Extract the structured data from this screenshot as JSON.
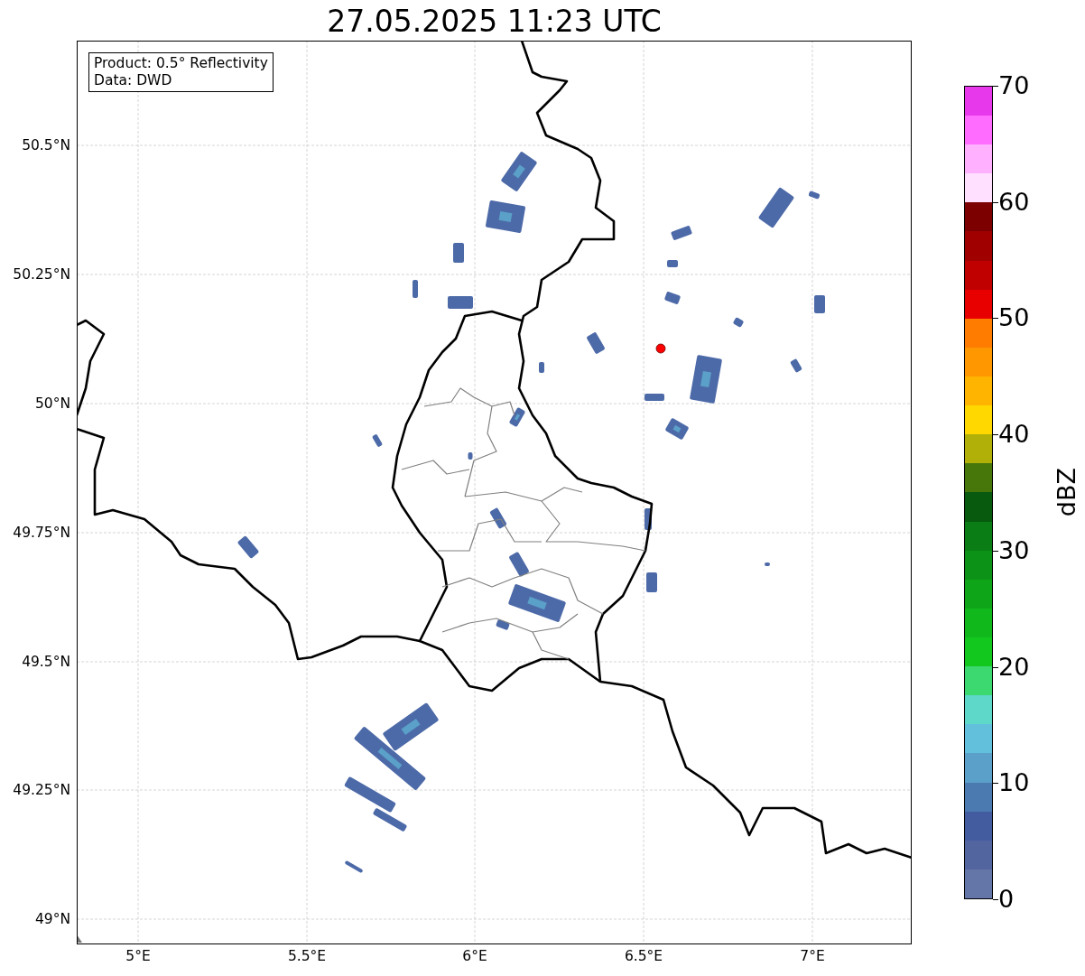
{
  "title": "27.05.2025 11:23 UTC",
  "map": {
    "info_lines": [
      "Product: 0.5° Reflectivity",
      "Data: DWD"
    ],
    "xtick_labels": [
      "5°E",
      "5.5°E",
      "6°E",
      "6.5°E",
      "7°E"
    ],
    "ytick_labels": [
      "50.5°N",
      "50.25°N",
      "50°N",
      "49.75°N",
      "49.5°N",
      "49.25°N",
      "49°N"
    ]
  },
  "colorbar": {
    "label": "dBZ",
    "tick_labels": [
      "70",
      "60",
      "50",
      "40",
      "30",
      "20",
      "10",
      "0"
    ],
    "bands": [
      {
        "color": "#6475a8"
      },
      {
        "color": "#52659f"
      },
      {
        "color": "#435b9f"
      },
      {
        "color": "#4a7ab0"
      },
      {
        "color": "#5aa0c8"
      },
      {
        "color": "#62c0dc"
      },
      {
        "color": "#5ed8c8"
      },
      {
        "color": "#3cd870"
      },
      {
        "color": "#12c81e"
      },
      {
        "color": "#10b81c"
      },
      {
        "color": "#0ea618"
      },
      {
        "color": "#0c9216"
      },
      {
        "color": "#0a7e14"
      },
      {
        "color": "#085a0e"
      },
      {
        "color": "#47760a"
      },
      {
        "color": "#b0b008"
      },
      {
        "color": "#ffd800"
      },
      {
        "color": "#ffb400"
      },
      {
        "color": "#ff9800"
      },
      {
        "color": "#ff7c00"
      },
      {
        "color": "#e80000"
      },
      {
        "color": "#c00000"
      },
      {
        "color": "#a00000"
      },
      {
        "color": "#7c0000"
      },
      {
        "color": "#ffe0ff"
      },
      {
        "color": "#ffb0ff"
      },
      {
        "color": "#ff6cff"
      },
      {
        "color": "#e838ec"
      }
    ]
  }
}
